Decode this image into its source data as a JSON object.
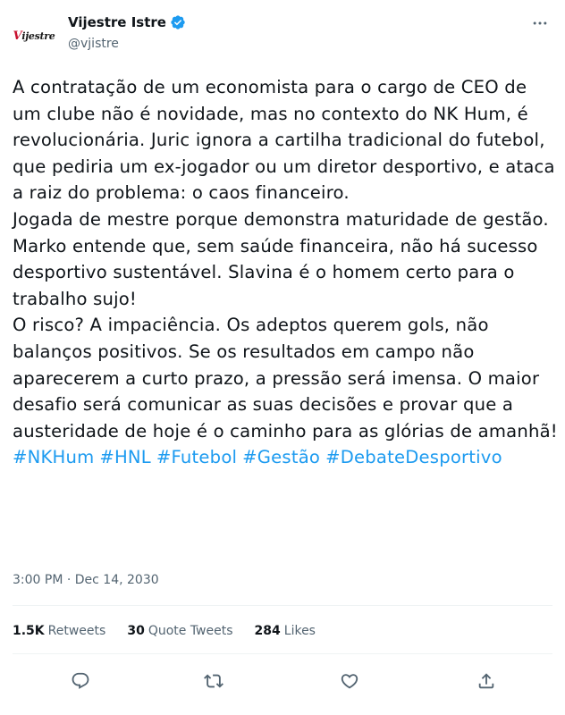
{
  "author": {
    "display_name": "Vijestre Istre",
    "handle": "@vjistre",
    "avatar_text": "Vijestre",
    "verified": true
  },
  "tweet": {
    "paragraphs": [
      "A contratação de um economista para o cargo de CEO de um clube não é novidade, mas no contexto do NK Hum, é revolucionária. Juric ignora a cartilha tradicional do futebol, que pediria um ex-jogador ou um diretor desportivo, e ataca a raiz do problema: o caos financeiro.",
      "Jogada de mestre porque demonstra maturidade de gestão. Marko entende que, sem saúde financeira, não há sucesso desportivo sustentável. Slavina é o homem certo para o trabalho sujo!",
      "O risco? A impaciência. Os adeptos querem gols, não balanços positivos. Se os resultados em campo não aparecerem a curto prazo, a pressão será imensa. O maior desafio será comunicar as suas decisões e provar que a austeridade de hoje é o caminho para as glórias de amanhã!"
    ],
    "hashtags": [
      "#NKHum",
      "#HNL",
      "#Futebol",
      "#Gestão",
      "#DebateDesportivo"
    ],
    "timestamp": "3:00 PM · Dec 14, 2030"
  },
  "stats": {
    "retweets_count": "1.5K",
    "retweets_label": "Retweets",
    "quotes_count": "30",
    "quotes_label": "Quote Tweets",
    "likes_count": "284",
    "likes_label": "Likes"
  },
  "actions": {
    "icons": [
      "reply-icon",
      "retweet-icon",
      "like-icon",
      "share-icon"
    ]
  },
  "colors": {
    "accent": "#1d9bf0",
    "text": "#0f1419",
    "muted": "#536471",
    "divider": "#eff3f4"
  }
}
